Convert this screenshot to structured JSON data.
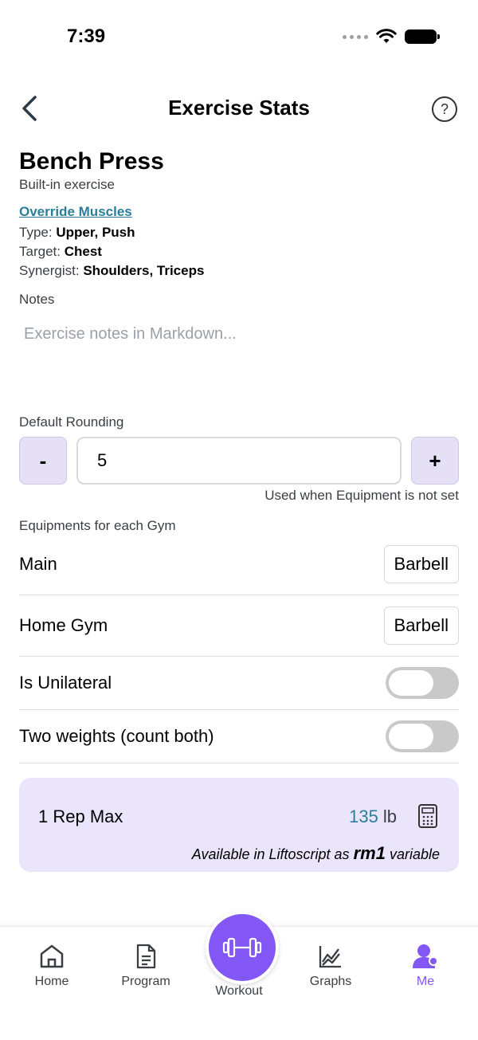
{
  "status": {
    "time": "7:39"
  },
  "header": {
    "title": "Exercise Stats",
    "help": "?"
  },
  "exercise": {
    "name": "Bench Press",
    "subtitle": "Built-in exercise",
    "override_label": "Override Muscles",
    "type_label": "Type:",
    "type_value": "Upper, Push",
    "target_label": "Target:",
    "target_value": "Chest",
    "synergist_label": "Synergist:",
    "synergist_value": "Shoulders, Triceps"
  },
  "notes": {
    "label": "Notes",
    "placeholder": "Exercise notes in Markdown..."
  },
  "rounding": {
    "label": "Default Rounding",
    "minus": "-",
    "plus": "+",
    "value": "5",
    "hint": "Used when Equipment is not set"
  },
  "equipments": {
    "label": "Equipments for each Gym",
    "gyms": [
      {
        "name": "Main",
        "equipment": "Barbell"
      },
      {
        "name": "Home Gym",
        "equipment": "Barbell"
      }
    ]
  },
  "toggles": {
    "unilateral": "Is Unilateral",
    "two_weights": "Two weights (count both)"
  },
  "rep_max": {
    "label": "1 Rep Max",
    "value": "135",
    "unit": "lb",
    "note_prefix": "Available in Liftoscript as",
    "note_var": "rm1",
    "note_suffix": "variable"
  },
  "tabs": {
    "home": "Home",
    "program": "Program",
    "workout": "Workout",
    "graphs": "Graphs",
    "me": "Me"
  },
  "colors": {
    "accent": "#8356f6",
    "link": "#2b7e9b",
    "card": "#ebe5fb",
    "stepper": "#e6e0f7"
  }
}
